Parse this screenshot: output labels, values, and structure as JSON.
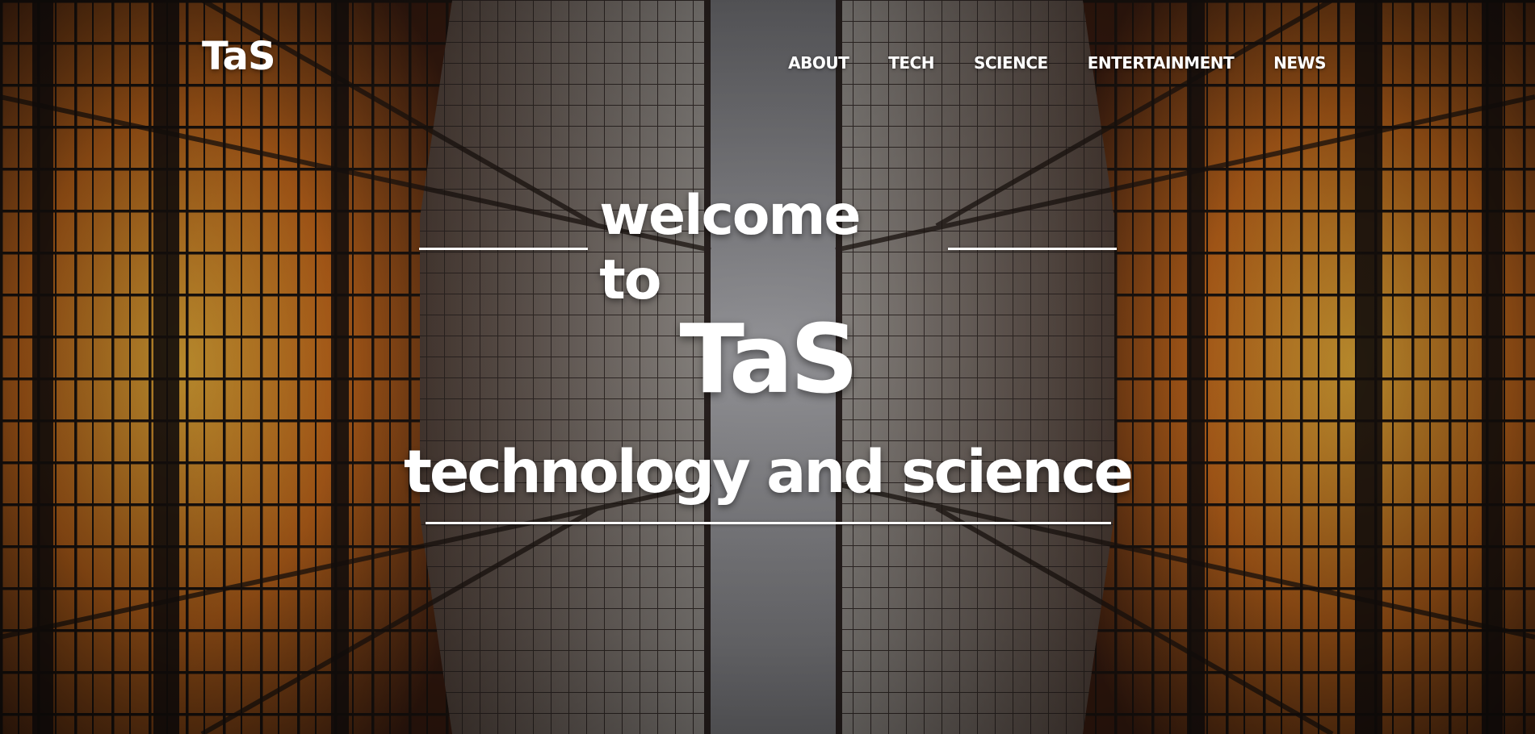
{
  "navbar": {
    "brand": "TaS",
    "links": [
      {
        "label": "ABOUT"
      },
      {
        "label": "TECH"
      },
      {
        "label": "SCIENCE"
      },
      {
        "label": "ENTERTAINMENT"
      },
      {
        "label": "NEWS"
      }
    ]
  },
  "hero": {
    "welcome": "welcome to",
    "title": "TaS",
    "subtitle": "technology and science",
    "background_image": "looking-up-between-glass-skyscrapers"
  },
  "colors": {
    "text": "#ffffff",
    "window_amber": "#e8931f",
    "window_orange": "#c4521a",
    "sky_gray": "#8a8a8e",
    "frame_dark": "#1a1412"
  }
}
